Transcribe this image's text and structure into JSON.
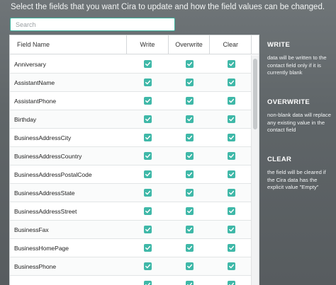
{
  "instruction": "Select the fields that you want Cira to update and how the field values can be changed.",
  "search": {
    "placeholder": "Search",
    "value": ""
  },
  "table": {
    "headers": {
      "name": "Field Name",
      "write": "Write",
      "overwrite": "Overwrite",
      "clear": "Clear"
    },
    "rows": [
      {
        "name": "Anniversary",
        "write": true,
        "overwrite": true,
        "clear": true
      },
      {
        "name": "AssistantName",
        "write": true,
        "overwrite": true,
        "clear": true
      },
      {
        "name": "AssistantPhone",
        "write": true,
        "overwrite": true,
        "clear": true
      },
      {
        "name": "Birthday",
        "write": true,
        "overwrite": true,
        "clear": true
      },
      {
        "name": "BusinessAddressCity",
        "write": true,
        "overwrite": true,
        "clear": true
      },
      {
        "name": "BusinessAddressCountry",
        "write": true,
        "overwrite": true,
        "clear": true
      },
      {
        "name": "BusinessAddressPostalCode",
        "write": true,
        "overwrite": true,
        "clear": true
      },
      {
        "name": "BusinessAddressState",
        "write": true,
        "overwrite": true,
        "clear": true
      },
      {
        "name": "BusinessAddressStreet",
        "write": true,
        "overwrite": true,
        "clear": true
      },
      {
        "name": "BusinessFax",
        "write": true,
        "overwrite": true,
        "clear": true
      },
      {
        "name": "BusinessHomePage",
        "write": true,
        "overwrite": true,
        "clear": true
      },
      {
        "name": "BusinessPhone",
        "write": true,
        "overwrite": true,
        "clear": true
      },
      {
        "name": "",
        "write": true,
        "overwrite": true,
        "clear": true
      }
    ]
  },
  "legend": {
    "write": {
      "title": "WRITE",
      "text": "data will be written to the contact field only if it is currently blank"
    },
    "overwrite": {
      "title": "OVERWRITE",
      "text": "non-blank data will replace any existing value in the contact field"
    },
    "clear": {
      "title": "CLEAR",
      "text": "the field will be cleared if the Cira data has the explicit value \"Empty\""
    }
  },
  "colors": {
    "accent": "#3fb8a8",
    "search_border": "#3db39e"
  },
  "icons": {
    "checkbox": "checkmark-icon"
  }
}
